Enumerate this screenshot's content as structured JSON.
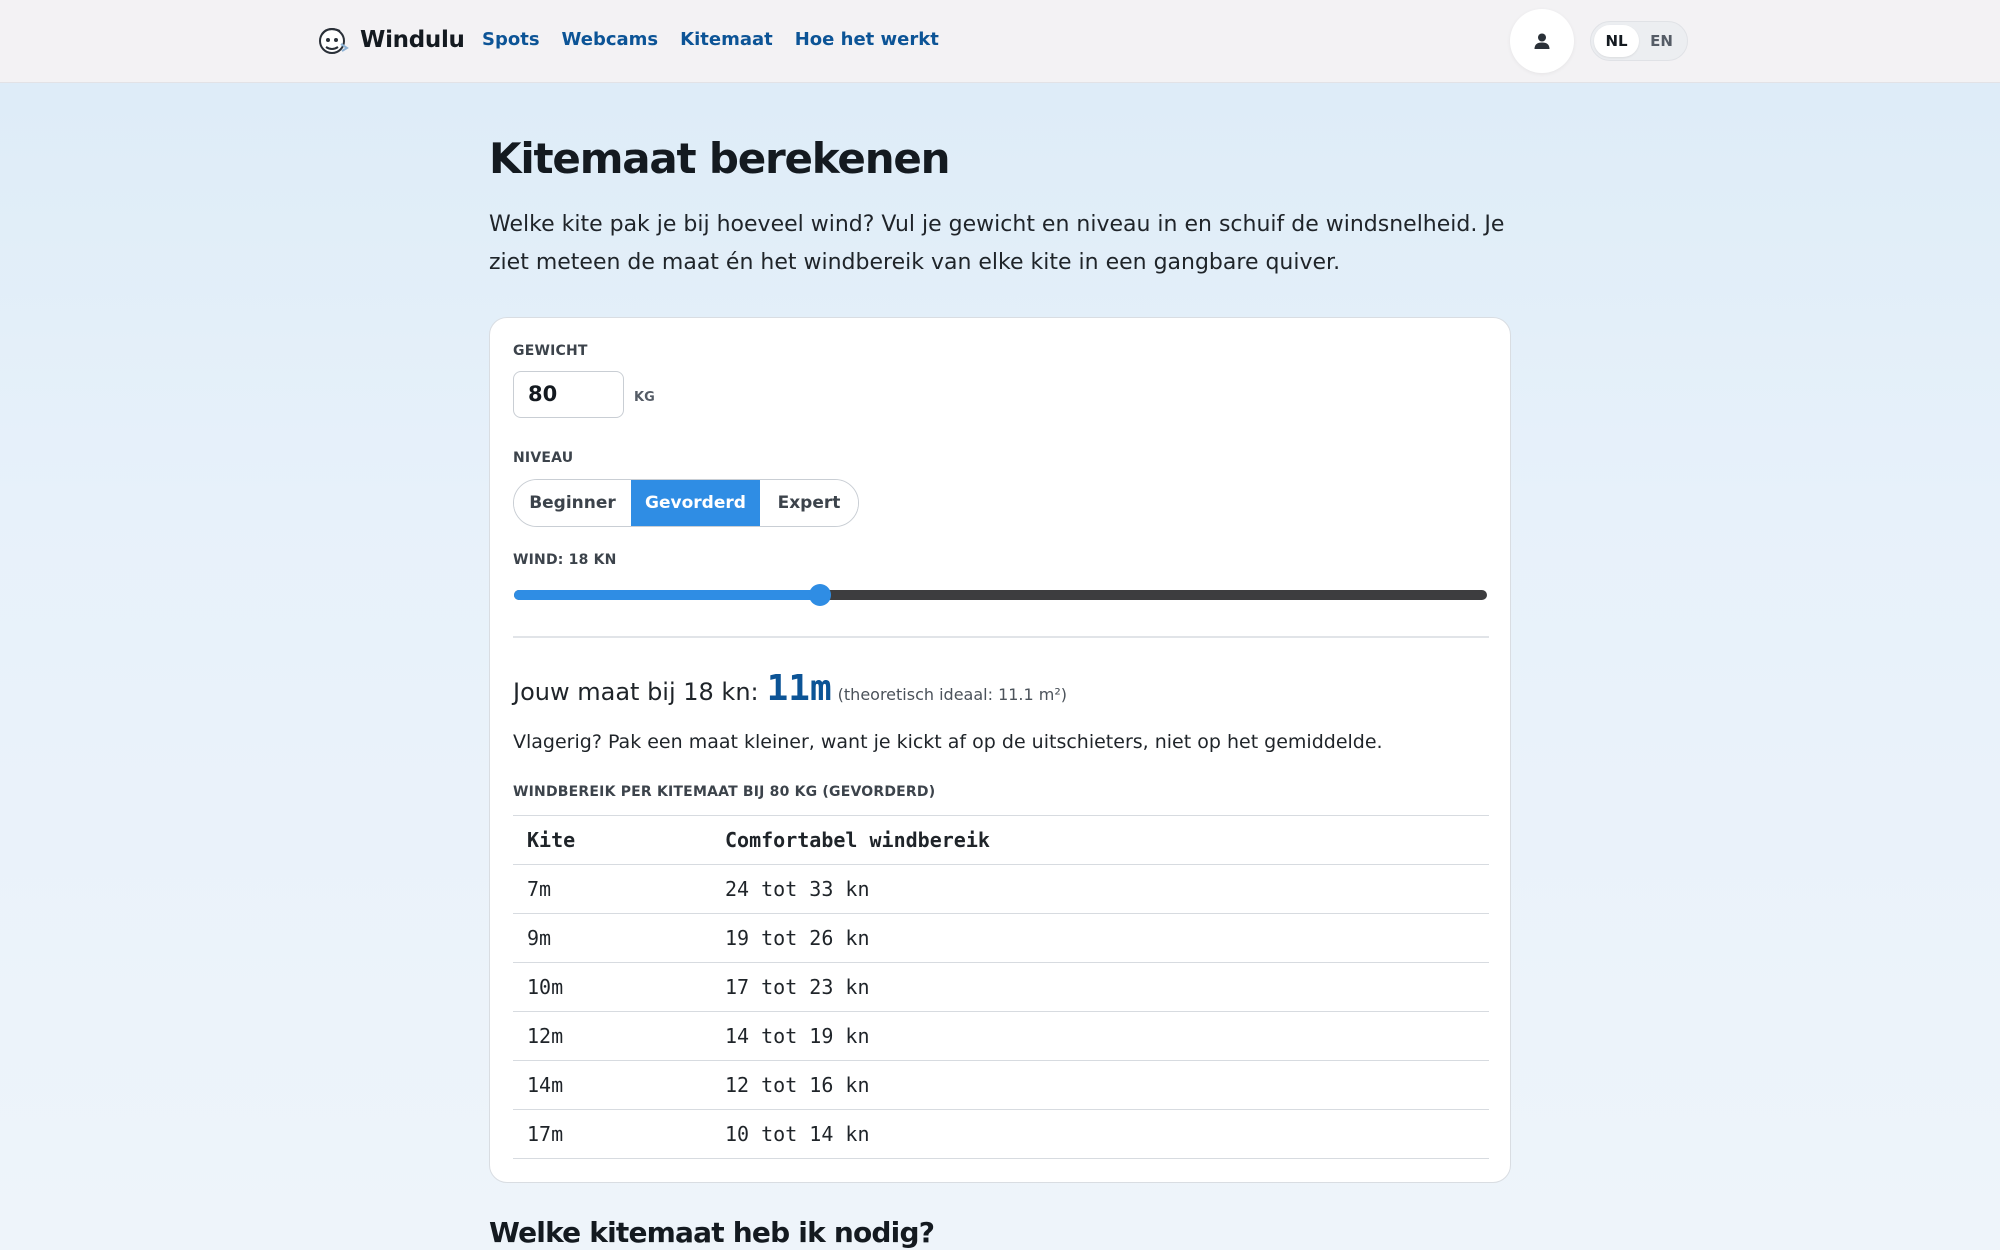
{
  "header": {
    "brand": "Windulu",
    "nav": [
      "Spots",
      "Webcams",
      "Kitemaat",
      "Hoe het werkt"
    ],
    "lang": {
      "options": [
        "NL",
        "EN"
      ],
      "active": "NL"
    }
  },
  "main": {
    "title": "Kitemaat berekenen",
    "intro": "Welke kite pak je bij hoeveel wind? Vul je gewicht en niveau in en schuif de windsnelheid. Je ziet meteen de maat én het windbereik van elke kite in een gangbare quiver."
  },
  "form": {
    "weight_label": "GEWICHT",
    "weight_value": "80",
    "weight_unit": "KG",
    "level_label": "NIVEAU",
    "levels": [
      "Beginner",
      "Gevorderd",
      "Expert"
    ],
    "selected_level": "Gevorderd",
    "wind_label": "WIND: 18 KN",
    "wind_slider_fraction": 0.315
  },
  "result": {
    "label": "Jouw maat bij 18 kn:",
    "size": "11m",
    "note": "(theoretisch ideaal: 11.1 m²)",
    "tip": "Vlagerig? Pak een maat kleiner, want je kickt af op de uitschieters, niet op het gemiddelde."
  },
  "table": {
    "caption": "WINDBEREIK PER KITEMAAT BIJ 80 KG (GEVORDERD)",
    "headers": [
      "Kite",
      "Comfortabel windbereik"
    ],
    "rows": [
      [
        "7m",
        "24 tot 33 kn"
      ],
      [
        "9m",
        "19 tot 26 kn"
      ],
      [
        "10m",
        "17 tot 23 kn"
      ],
      [
        "12m",
        "14 tot 19 kn"
      ],
      [
        "14m",
        "12 tot 16 kn"
      ],
      [
        "17m",
        "10 tot 14 kn"
      ]
    ]
  },
  "section2": {
    "title": "Welke kitemaat heb ik nodig?"
  },
  "colors": {
    "accent": "#2f8de4",
    "link": "#0c5496",
    "track": "#3d3d3f"
  },
  "icons": {
    "logo": "windulu-logo-icon",
    "user": "user-icon"
  }
}
